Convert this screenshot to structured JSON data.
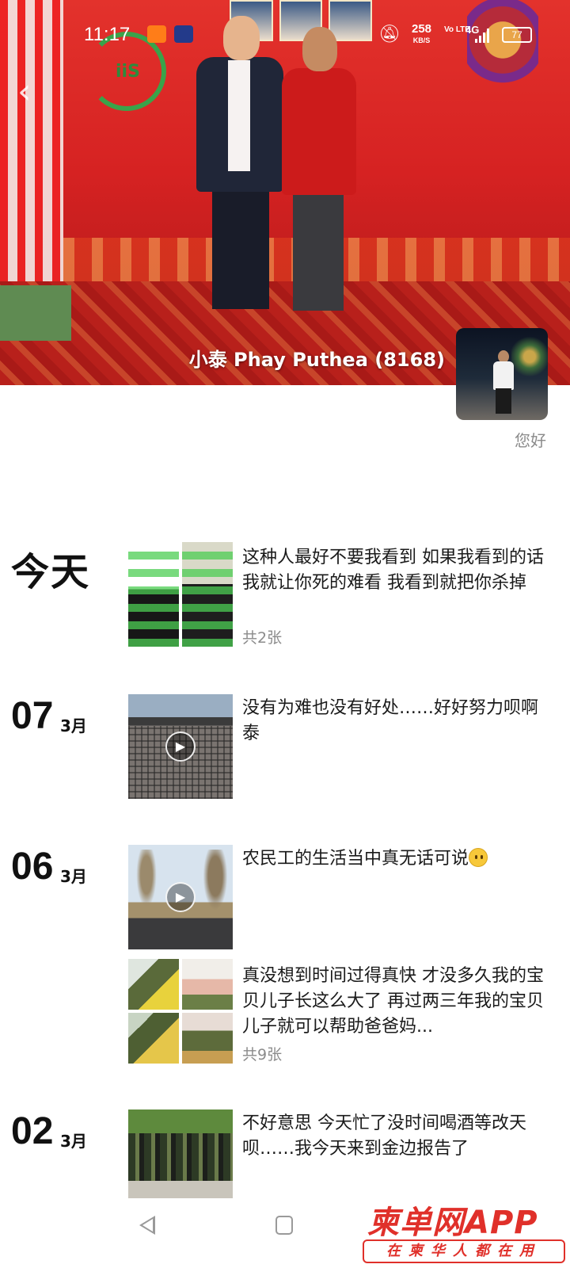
{
  "status_bar": {
    "time": "11:17",
    "net_speed_value": "258",
    "net_speed_unit": "KB/S",
    "volte": "Vo LTE",
    "network_type": "4G",
    "battery": "77"
  },
  "profile": {
    "display_name": "小泰 Phay Puthea (8168)",
    "signature": "您好"
  },
  "feed": [
    {
      "date_label": "今天",
      "posts": [
        {
          "text": "这种人最好不要我看到 如果我看到的话我就让你死的难看  我看到就把你杀掉",
          "count": "共2张"
        }
      ]
    },
    {
      "day": "07",
      "month": "3月",
      "posts": [
        {
          "text": "没有为难也没有好处……好好努力呗啊泰"
        }
      ]
    },
    {
      "day": "06",
      "month": "3月",
      "posts": [
        {
          "text": "农民工的生活当中真无话可说"
        },
        {
          "text": "真没想到时间过得真快 才没多久我的宝贝儿子长这么大了 再过两三年我的宝贝儿子就可以帮助爸爸妈...",
          "count": "共9张"
        }
      ]
    },
    {
      "day": "02",
      "month": "3月",
      "posts": [
        {
          "text": "不好意思 今天忙了没时间喝酒等改天呗……我今天来到金边报告了"
        }
      ]
    }
  ],
  "watermark": {
    "brand": "柬单网APP",
    "slogan": "在柬华人都在用"
  },
  "colors": {
    "brand_red": "#e0302a",
    "secondary_text": "#8b8b8b"
  },
  "icons": {
    "back": "chevron-left",
    "play": "play-triangle",
    "nav_back": "triangle-left",
    "nav_home": "square"
  }
}
